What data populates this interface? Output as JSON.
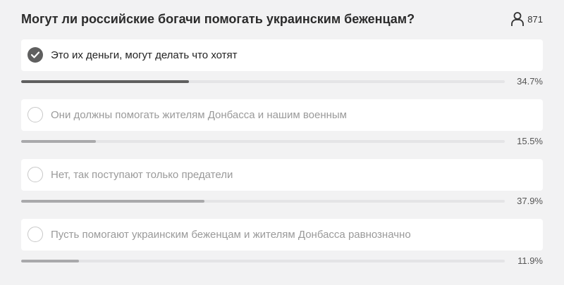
{
  "poll": {
    "question": "Могут ли российские богачи помогать украинским беженцам?",
    "voters": {
      "icon": "user-icon",
      "count": "871"
    },
    "options": [
      {
        "label": "Это их деньги, могут делать что хотят",
        "percent": "34.7%",
        "fraction": 0.347,
        "selected": true
      },
      {
        "label": "Они должны помогать жителям Донбасса и нашим военным",
        "percent": "15.5%",
        "fraction": 0.155,
        "selected": false
      },
      {
        "label": "Нет, так поступают только предатели",
        "percent": "37.9%",
        "fraction": 0.379,
        "selected": false
      },
      {
        "label": "Пусть помогают украинским беженцам и жителям Донбасса равнозначно",
        "percent": "11.9%",
        "fraction": 0.119,
        "selected": false
      }
    ]
  },
  "colors": {
    "background": "#f2f2f3",
    "option_background": "#ffffff",
    "selected_accent": "#5f5f5f",
    "unselected_bar": "#a9a9ab",
    "track": "#e4e4e6"
  }
}
